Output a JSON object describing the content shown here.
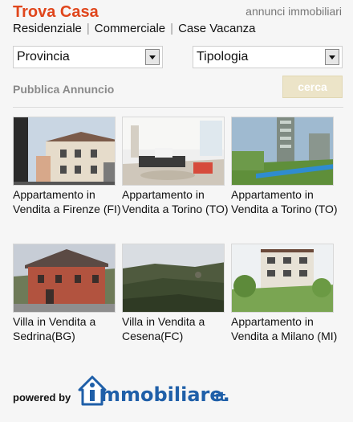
{
  "header": {
    "brand": "Trova Casa",
    "tagline": "annunci immobiliari",
    "nav": [
      "Residenziale",
      "Commerciale",
      "Case Vacanza"
    ]
  },
  "filters": {
    "provincia": "Provincia",
    "tipologia": "Tipologia"
  },
  "actions": {
    "publish": "Pubblica Annuncio",
    "search": "cerca"
  },
  "listings": [
    {
      "caption": "Appartamento in Vendita a Firenze (FI)"
    },
    {
      "caption": "Appartamento in Vendita a Torino (TO)"
    },
    {
      "caption": "Appartamento in Vendita a Torino (TO)"
    },
    {
      "caption": "Villa in Vendita a Sedrina(BG)"
    },
    {
      "caption": "Villa in Vendita a Cesena(FC)"
    },
    {
      "caption": "Appartamento in Vendita a Milano (MI)"
    }
  ],
  "footer": {
    "powered_by": "powered by",
    "logo_text": "immobiliare.it"
  },
  "colors": {
    "brand": "#e0461c",
    "logo_blue": "#1f5fa8",
    "search_bg": "#ece4c8"
  }
}
